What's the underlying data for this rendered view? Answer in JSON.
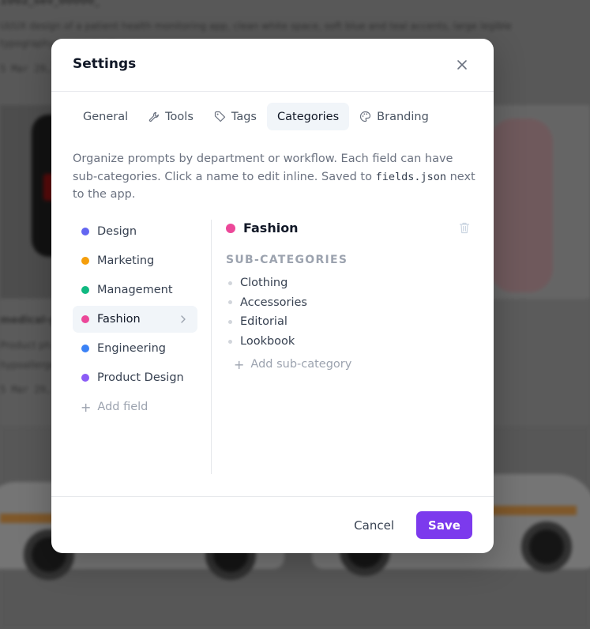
{
  "background": {
    "card_title_top": "1002_sev_00000_",
    "card_desc_top_1": "UI/UX design of a patient health monitoring app, clean white space, soft blue and teal accents, large legible",
    "card_desc_top_2": "typography ... app mockup on...",
    "card_date_top": "5 Mar 29, ...",
    "card_title_mid": "medical-g...",
    "card_desc_mid_1": "Product ph... able",
    "card_desc_mid_2": "hypoallerge... lifestyle lighting...",
    "card_date_mid": "5 Mar 29, ..."
  },
  "modal": {
    "title": "Settings",
    "close_icon": "close-icon",
    "tabs": [
      {
        "label": "General",
        "icon": ""
      },
      {
        "label": "Tools",
        "icon": "wrench-icon"
      },
      {
        "label": "Tags",
        "icon": "tag-icon"
      },
      {
        "label": "Categories",
        "icon": "",
        "active": true
      },
      {
        "label": "Branding",
        "icon": "palette-icon"
      }
    ],
    "description": {
      "before_code": "Organize prompts by department or workflow. Each field can have sub-categories. Click a name to edit inline. Saved to ",
      "code": "fields.json",
      "after_code": " next to the app."
    },
    "fields": [
      {
        "label": "Design",
        "color": "#6366f1"
      },
      {
        "label": "Marketing",
        "color": "#f59e0b"
      },
      {
        "label": "Management",
        "color": "#10b981"
      },
      {
        "label": "Fashion",
        "color": "#ec4899",
        "active": true
      },
      {
        "label": "Engineering",
        "color": "#3b82f6"
      },
      {
        "label": "Product Design",
        "color": "#8b5cf6"
      }
    ],
    "add_field_label": "Add field",
    "detail": {
      "title": "Fashion",
      "color": "#ec4899",
      "sub_heading": "SUB-CATEGORIES",
      "sub_categories": [
        "Clothing",
        "Accessories",
        "Editorial",
        "Lookbook"
      ],
      "add_sub_label": "Add sub-category"
    },
    "footer": {
      "cancel_label": "Cancel",
      "save_label": "Save",
      "save_color": "#7c3aed"
    }
  }
}
